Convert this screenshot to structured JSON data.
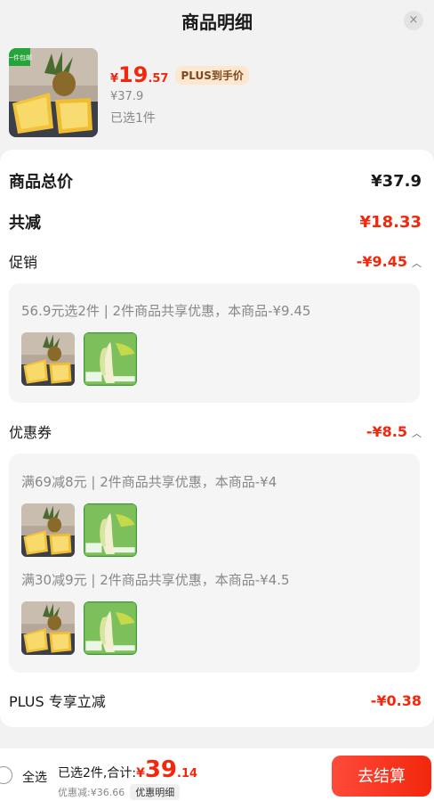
{
  "header": {
    "title": "商品明细",
    "close_symbol": "×"
  },
  "product": {
    "badge": "一件包邮",
    "price_symbol": "¥",
    "price_int": "19",
    "price_dec": ".57",
    "plus_tag": "PLUS到手价",
    "original_price": "¥37.9",
    "picked": "已选1件"
  },
  "summary": {
    "total_label": "商品总价",
    "total_value": "¥37.9",
    "reduce_label": "共减",
    "reduce_value": "¥18.33"
  },
  "promotion": {
    "label": "促销",
    "value": "-¥9.45",
    "rule": "56.9元选2件 | 2件商品共享优惠，本商品-¥9.45"
  },
  "coupon": {
    "label": "优惠券",
    "value": "-¥8.5",
    "rules": [
      "满69减8元 | 2件商品共享优惠，本商品-¥4",
      "满30减9元 | 2件商品共享优惠，本商品-¥4.5"
    ]
  },
  "plus": {
    "label": "PLUS 专享立减",
    "value": "-¥0.38"
  },
  "bottom": {
    "select_all": "全选",
    "summary_prefix": "已选2件,合计:",
    "total_symbol": "¥",
    "total_int": "39",
    "total_dec": ".14",
    "discount": "优惠减:¥36.66",
    "detail_button": "优惠明细",
    "checkout_button": "去结算"
  },
  "colors": {
    "accent": "#f2270c",
    "plus_tag_bg": "#fde7cf",
    "box_bg": "#f5f5f5"
  },
  "icons": {
    "close": "close-icon",
    "expand": "chevron-up-icon",
    "radio": "radio-unchecked-icon"
  }
}
